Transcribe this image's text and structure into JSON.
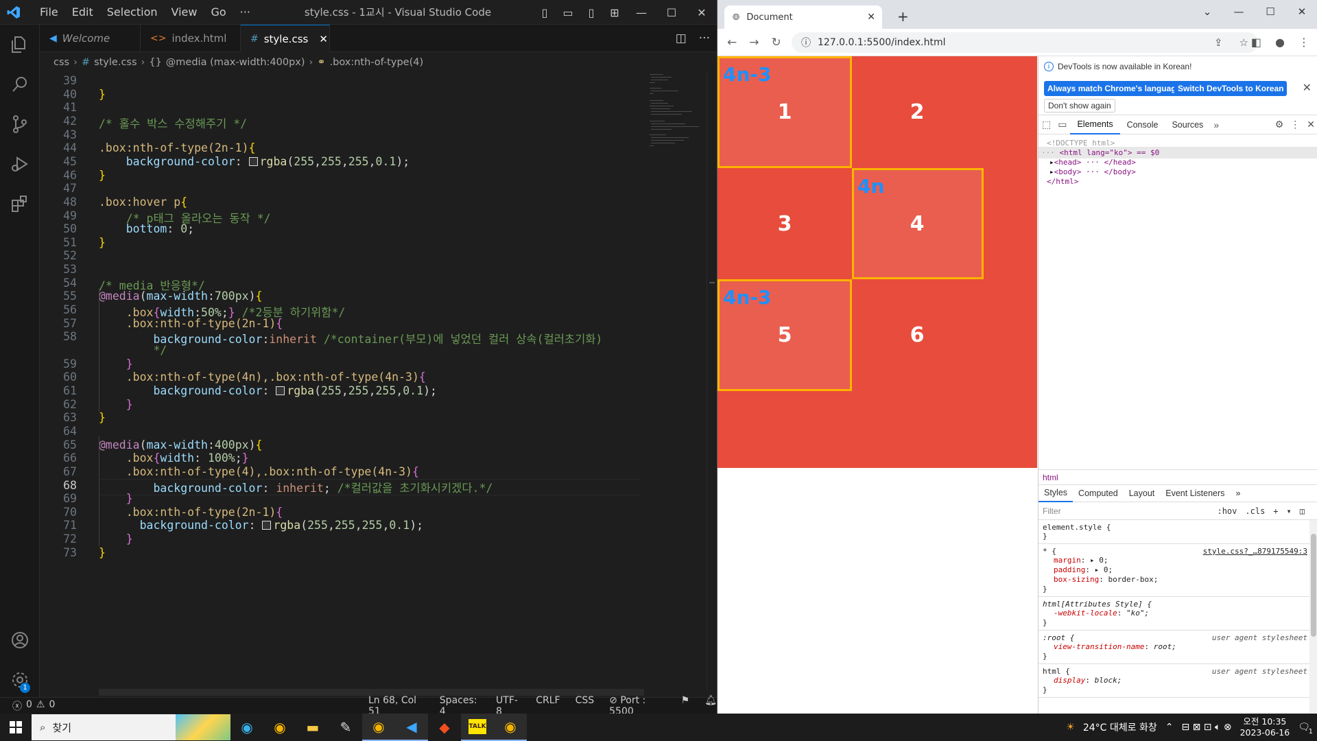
{
  "vscode": {
    "menu": [
      "File",
      "Edit",
      "Selection",
      "View",
      "Go",
      "···"
    ],
    "window_title": "style.css - 1교시 - Visual Studio Code",
    "tabs": [
      {
        "label": "Welcome",
        "icon": "vscode-icon"
      },
      {
        "label": "index.html",
        "icon": "html-icon"
      },
      {
        "label": "style.css",
        "icon": "css-icon"
      }
    ],
    "breadcrumb": [
      "css",
      "#",
      "style.css",
      "{}",
      "@media (max-width:400px)",
      ".box:nth-of-type(4)"
    ],
    "editor_lines": [
      {
        "n": "39",
        "html": ""
      },
      {
        "n": "40",
        "html": "<span class=\"c-br\">}</span>"
      },
      {
        "n": "41",
        "html": ""
      },
      {
        "n": "42",
        "html": "<span class=\"c-cmt\">/* 홀수 박스 수정해주기 */</span>"
      },
      {
        "n": "43",
        "html": ""
      },
      {
        "n": "44",
        "html": "<span class=\"c-sel\">.box:nth-of-type(2n-1)</span><span class=\"c-br\">{</span>"
      },
      {
        "n": "45",
        "html": "    <span class=\"c-prop\">background-color</span>: <span class=\"swatch\"></span><span class=\"c-fn\">rgba</span>(<span class=\"c-num\">255</span>,<span class=\"c-num\">255</span>,<span class=\"c-num\">255</span>,<span class=\"c-num\">0.1</span>);"
      },
      {
        "n": "46",
        "html": "<span class=\"c-br\">}</span>"
      },
      {
        "n": "47",
        "html": ""
      },
      {
        "n": "48",
        "html": "<span class=\"c-sel\">.box:hover p</span><span class=\"c-br\">{</span>"
      },
      {
        "n": "49",
        "html": "    <span class=\"c-cmt\">/* p태그 올라오는 동작 */</span>"
      },
      {
        "n": "50",
        "html": "    <span class=\"c-prop\">bottom</span>: <span class=\"c-num\">0</span>;"
      },
      {
        "n": "51",
        "html": "<span class=\"c-br\">}</span>"
      },
      {
        "n": "52",
        "html": ""
      },
      {
        "n": "53",
        "html": ""
      },
      {
        "n": "54",
        "html": "<span class=\"c-cmt\">/* media 반응형*/</span>"
      },
      {
        "n": "55",
        "html": "<span class=\"c-at\">@media</span>(<span class=\"c-prop\">max-width</span>:<span class=\"c-num\">700px</span>)<span class=\"c-br\">{</span>"
      },
      {
        "n": "56",
        "html": "    <span class=\"c-sel\">.box</span><span class=\"c-br2\">{</span><span class=\"c-prop\">width</span>:<span class=\"c-num\">50%</span>;<span class=\"c-br2\">}</span> <span class=\"c-cmt\">/*2등분 하기위함*/</span>"
      },
      {
        "n": "57",
        "html": "    <span class=\"c-sel\">.box:nth-of-type(2n-1)</span><span class=\"c-br2\">{</span>"
      },
      {
        "n": "58",
        "html": "        <span class=\"c-prop\">background-color</span>:<span class=\"c-val\">inherit</span> <span class=\"c-cmt\">/*container(부모)에 넣었던 컬러 상속(컬러초기화)</span>"
      },
      {
        "n": "",
        "html": "        <span class=\"c-cmt\">*/</span>"
      },
      {
        "n": "59",
        "html": "    <span class=\"c-br2\">}</span>"
      },
      {
        "n": "60",
        "html": "    <span class=\"c-sel\">.box:nth-of-type(4n),.box:nth-of-type(4n-3)</span><span class=\"c-br2\">{</span>"
      },
      {
        "n": "61",
        "html": "        <span class=\"c-prop\">background-color</span>: <span class=\"swatch\"></span><span class=\"c-fn\">rgba</span>(<span class=\"c-num\">255</span>,<span class=\"c-num\">255</span>,<span class=\"c-num\">255</span>,<span class=\"c-num\">0.1</span>);"
      },
      {
        "n": "62",
        "html": "    <span class=\"c-br2\">}</span>"
      },
      {
        "n": "63",
        "html": "<span class=\"c-br\">}</span>"
      },
      {
        "n": "64",
        "html": ""
      },
      {
        "n": "65",
        "html": "<span class=\"c-at\">@media</span>(<span class=\"c-prop\">max-width</span>:<span class=\"c-num\">400px</span>)<span class=\"c-br\">{</span>"
      },
      {
        "n": "66",
        "html": "    <span class=\"c-sel\">.box</span><span class=\"c-br2\">{</span><span class=\"c-prop\">width</span>: <span class=\"c-num\">100%</span>;<span class=\"c-br2\">}</span>"
      },
      {
        "n": "67",
        "html": "    <span class=\"c-sel\">.box:nth-of-type(4),.box:nth-of-type(4n-3)</span><span class=\"c-br2\">{</span>"
      },
      {
        "n": "68",
        "html": "        <span class=\"c-prop\">background-color</span>: <span class=\"c-val\">inherit</span>; <span class=\"c-cmt\">/*컬러값을 초기화시키겠다.*/</span>"
      },
      {
        "n": "69",
        "html": "    <span class=\"c-br2\">}</span>"
      },
      {
        "n": "70",
        "html": "    <span class=\"c-sel\">.box:nth-of-type(2n-1)</span><span class=\"c-br2\">{</span>"
      },
      {
        "n": "71",
        "html": "      <span class=\"c-prop\">background-color</span>: <span class=\"swatch\"></span><span class=\"c-fn\">rgba</span>(<span class=\"c-num\">255</span>,<span class=\"c-num\">255</span>,<span class=\"c-num\">255</span>,<span class=\"c-num\">0.1</span>);"
      },
      {
        "n": "72",
        "html": "    <span class=\"c-br2\">}</span>"
      },
      {
        "n": "73",
        "html": "<span class=\"c-br\">}</span>"
      }
    ],
    "current_line": "68",
    "status": {
      "errors": "0",
      "warnings": "0",
      "position": "Ln 68, Col 51",
      "spaces": "Spaces: 4",
      "encoding": "UTF-8",
      "eol": "CRLF",
      "language": "CSS",
      "port": "Port : 5500"
    }
  },
  "chrome": {
    "tab_title": "Document",
    "url": "127.0.0.1:5500/index.html",
    "boxes": [
      {
        "num": "1",
        "label": "4n-3",
        "light": true,
        "outlined": true
      },
      {
        "num": "2",
        "label": "",
        "light": false,
        "outlined": false
      },
      {
        "num": "3",
        "label": "",
        "light": false,
        "outlined": false
      },
      {
        "num": "4",
        "label": "4n",
        "light": true,
        "outlined": true
      },
      {
        "num": "5",
        "label": "4n-3",
        "light": true,
        "outlined": true
      },
      {
        "num": "6",
        "label": "",
        "light": false,
        "outlined": false
      }
    ],
    "colors": {
      "box_red": "#e74c3c",
      "outline": "#ffb400",
      "label_blue": "#1e90ff"
    }
  },
  "devtools": {
    "notice": "DevTools is now available in Korean!",
    "btn_match": "Always match Chrome's language",
    "btn_switch": "Switch DevTools to Korean",
    "btn_dont": "Don't show again",
    "tabs": [
      "Elements",
      "Console",
      "Sources"
    ],
    "dom": [
      {
        "text": "<!DOCTYPE html>"
      },
      {
        "text": "<html lang=\"ko\"> == $0"
      },
      {
        "text": "<head> ··· </head>"
      },
      {
        "text": "<body> ··· </body>"
      },
      {
        "text": "</html>"
      }
    ],
    "crumb": "html",
    "subtabs": [
      "Styles",
      "Computed",
      "Layout",
      "Event Listeners"
    ],
    "filter_placeholder": "Filter",
    "filter_buttons": [
      ":hov",
      ".cls",
      "+"
    ],
    "rules": [
      {
        "selector": "element.style {",
        "source": "",
        "ua": "",
        "decls": [],
        "close": "}"
      },
      {
        "selector": "* {",
        "source": "style.css?_…879175549:3",
        "ua": "",
        "decls": [
          {
            "p": "margin",
            "v": "▸ 0;"
          },
          {
            "p": "padding",
            "v": "▸ 0;"
          },
          {
            "p": "box-sizing",
            "v": "border-box;"
          }
        ],
        "close": "}"
      },
      {
        "selector": "html[Attributes Style] {",
        "source": "",
        "ua": "",
        "decls": [
          {
            "p": "-webkit-locale",
            "v": "\"ko\";"
          }
        ],
        "close": "}"
      },
      {
        "selector": ":root {",
        "source": "",
        "ua": "user agent stylesheet",
        "decls": [
          {
            "p": "view-transition-name",
            "v": "root;"
          }
        ],
        "close": "}"
      },
      {
        "selector": "html {",
        "source": "",
        "ua": "user agent stylesheet",
        "decls": [
          {
            "p": "display",
            "v": "block;"
          }
        ],
        "close": "}"
      }
    ]
  },
  "taskbar": {
    "search": "찾기",
    "weather": "24°C 대체로 화창",
    "time": "오전 10:35",
    "date": "2023-06-16",
    "notifications": "1"
  }
}
